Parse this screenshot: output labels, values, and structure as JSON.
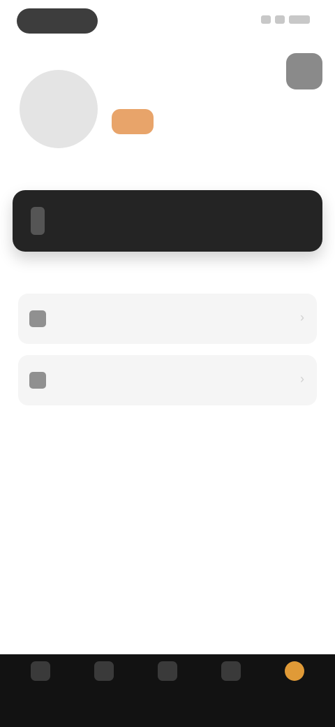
{
  "status_bar": {
    "time": "",
    "icons": [
      "signal-icon",
      "wifi-icon",
      "battery-icon"
    ]
  },
  "header": {
    "action_icon": "settings-icon"
  },
  "profile": {
    "name": "",
    "level_badge": ""
  },
  "banner": {
    "icon": "lock-icon",
    "text": ""
  },
  "menu": [
    {
      "icon": "document-icon",
      "label": ""
    },
    {
      "icon": "wallet-icon",
      "label": ""
    }
  ],
  "bottom_nav": [
    {
      "icon": "home-icon",
      "label": ""
    },
    {
      "icon": "discover-icon",
      "label": ""
    },
    {
      "icon": "add-icon",
      "label": ""
    },
    {
      "icon": "message-icon",
      "label": ""
    },
    {
      "icon": "profile-icon",
      "label": "",
      "active": true
    }
  ],
  "colors": {
    "accent": "#e09a37",
    "badge": "#e8a46a",
    "banner_bg": "#242424",
    "nav_bg": "#121212"
  }
}
